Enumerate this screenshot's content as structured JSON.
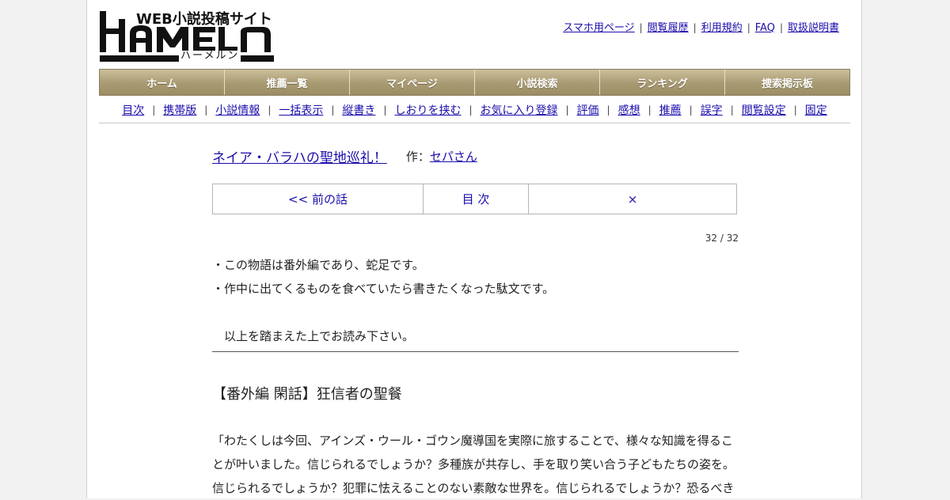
{
  "logo": {
    "tagline": "WEB小説投稿サイト",
    "wordmark": "HAMELN",
    "kana": "ハーメルン"
  },
  "top_links": [
    "スマホ用ページ",
    "閲覧履歴",
    "利用規約",
    "FAQ",
    "取扱説明書"
  ],
  "main_menu": [
    "ホーム",
    "推薦一覧",
    "マイページ",
    "小説検索",
    "ランキング",
    "捜索掲示板"
  ],
  "sub_nav": [
    "目次",
    "携帯版",
    "小説情報",
    "一括表示",
    "縦書き",
    "しおりを挟む",
    "お気に入り登録",
    "評価",
    "感想",
    "推薦",
    "誤字",
    "閲覧設定",
    "固定"
  ],
  "novel": {
    "title": "ネイア・バラハの聖地巡礼！",
    "author_prefix": "作：",
    "author": "セパさん"
  },
  "pager": {
    "prev": "<< 前の話",
    "toc": "目 次",
    "next": "×"
  },
  "page_count": "32 / 32",
  "preface": {
    "line1": "・この物語は番外編であり、蛇足です。",
    "line2": "・作中に出てくるものを食べていたら書きたくなった駄文です。",
    "line3": "　以上を踏まえた上でお読み下さい。"
  },
  "chapter_title": "【番外編 閑話】狂信者の聖餐",
  "body": {
    "line1": "「わたくしは今回、アインズ・ウール・ゴウン魔導国を実際に旅することで、様々な知識を得るこ",
    "line2": "とが叶いました。信じられるでしょうか？多種族が共存し、手を取り笑い合う子どもたちの姿を。",
    "line3": "信じられるでしょうか？犯罪に怯えることのない素敵な世界を。信じられるでしょうか？恐るべき"
  }
}
